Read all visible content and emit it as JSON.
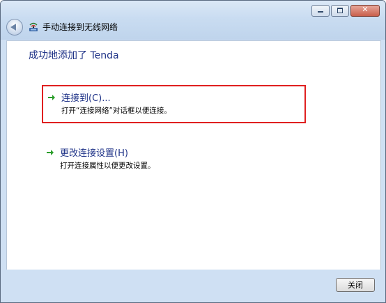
{
  "window": {
    "title": "手动连接到无线网络",
    "controls": {
      "close_glyph": "✕"
    }
  },
  "icons": {
    "back": "back-arrow-icon",
    "network": "wireless-network-icon",
    "option_arrow": "green-arrow-icon"
  },
  "main": {
    "heading": "成功地添加了 Tenda",
    "options": [
      {
        "title": "连接到(C)...",
        "description": "打开“连接网络”对话框以便连接。",
        "highlighted": true
      },
      {
        "title": "更改连接设置(H)",
        "description": "打开连接属性以便更改设置。",
        "highlighted": false
      }
    ]
  },
  "footer": {
    "close_label": "关闭"
  },
  "colors": {
    "heading": "#1e3287",
    "highlight_border": "#e02020",
    "arrow": "#2a9d2a",
    "chrome": "#cfe0f3"
  }
}
